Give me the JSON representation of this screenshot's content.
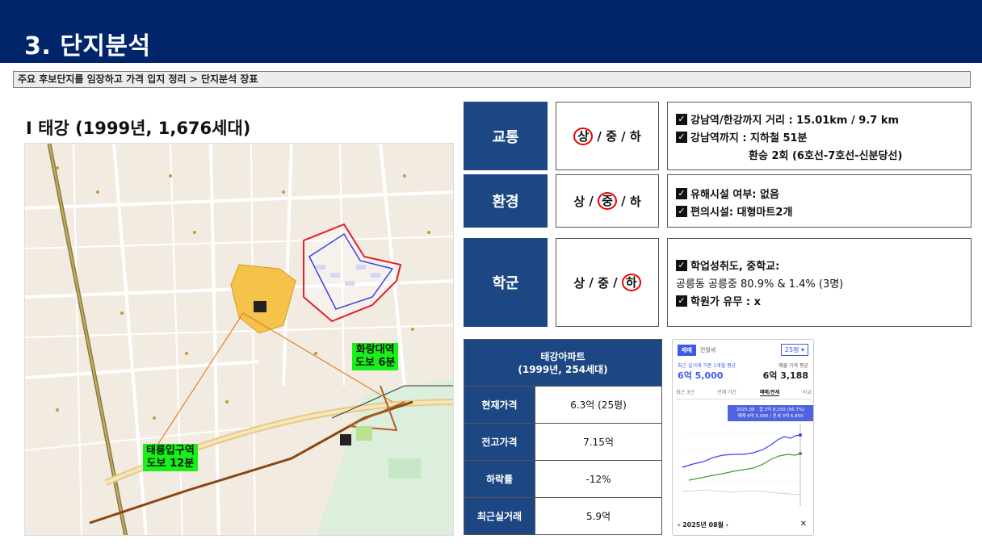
{
  "header": {
    "title": "3. 단지분석"
  },
  "subheader": {
    "text": "주요 후보단지를 임장하고 가격 입지 정리 > 단지분석 장표"
  },
  "complex": {
    "title": "I 태강 (1999년, 1,676세대)"
  },
  "map": {
    "labels": [
      {
        "line1": "화랑대역",
        "line2": "도보 6분"
      },
      {
        "line1": "태릉입구역",
        "line2": "도보 12분"
      }
    ]
  },
  "ratings": [
    {
      "category": "교통",
      "options": [
        "상",
        "중",
        "하"
      ],
      "selected": "상",
      "details": [
        "강남역/한강까지 거리 : 15.01km / 9.7 km",
        "강남역까지 : 지하철 51분",
        "환승 2회 (6호선-7호선-신분당선)"
      ]
    },
    {
      "category": "환경",
      "options": [
        "상",
        "중",
        "하"
      ],
      "selected": "중",
      "details": [
        "유해시설 여부: 없음",
        "편의시설: 대형마트2개"
      ]
    },
    {
      "category": "학군",
      "options": [
        "상",
        "중",
        "하"
      ],
      "selected": "하",
      "details": [
        "학업성취도, 중학교:",
        "공릉동 공릉중 80.9% & 1.4% (3명)",
        "학원가 유무 : x"
      ]
    }
  ],
  "price_table": {
    "header_line1": "태강아파트",
    "header_line2": "(1999년, 254세대)",
    "rows": [
      {
        "label": "현재가격",
        "value": "6.3억 (25평)"
      },
      {
        "label": "전고가격",
        "value": "7.15억"
      },
      {
        "label": "하락률",
        "value": "-12%"
      },
      {
        "label": "최근실거래",
        "value": "5.9억"
      }
    ]
  },
  "price_widget": {
    "tab_active": "매매",
    "tab_inactive": "전월세",
    "size": "25평",
    "left_label": "최근 실거래 기준 1개월 평균",
    "left_price": "6억 5,000",
    "right_label": "매물 가격 평균",
    "right_price": "6억 3,188",
    "periods": [
      "최근 3년",
      "전체 기간",
      "매매/전세",
      "비교"
    ],
    "active_period": "매매/전세",
    "tooltip_line1": "2025.08 · 갭 2억 8,150 (56.7%)",
    "tooltip_line2": "매매 6억 5,000 / 전세 3억 6,850",
    "footer_date": "2025년 08월",
    "colors": {
      "sale": "#3a3ff0",
      "lease": "#3a9a3a"
    }
  }
}
